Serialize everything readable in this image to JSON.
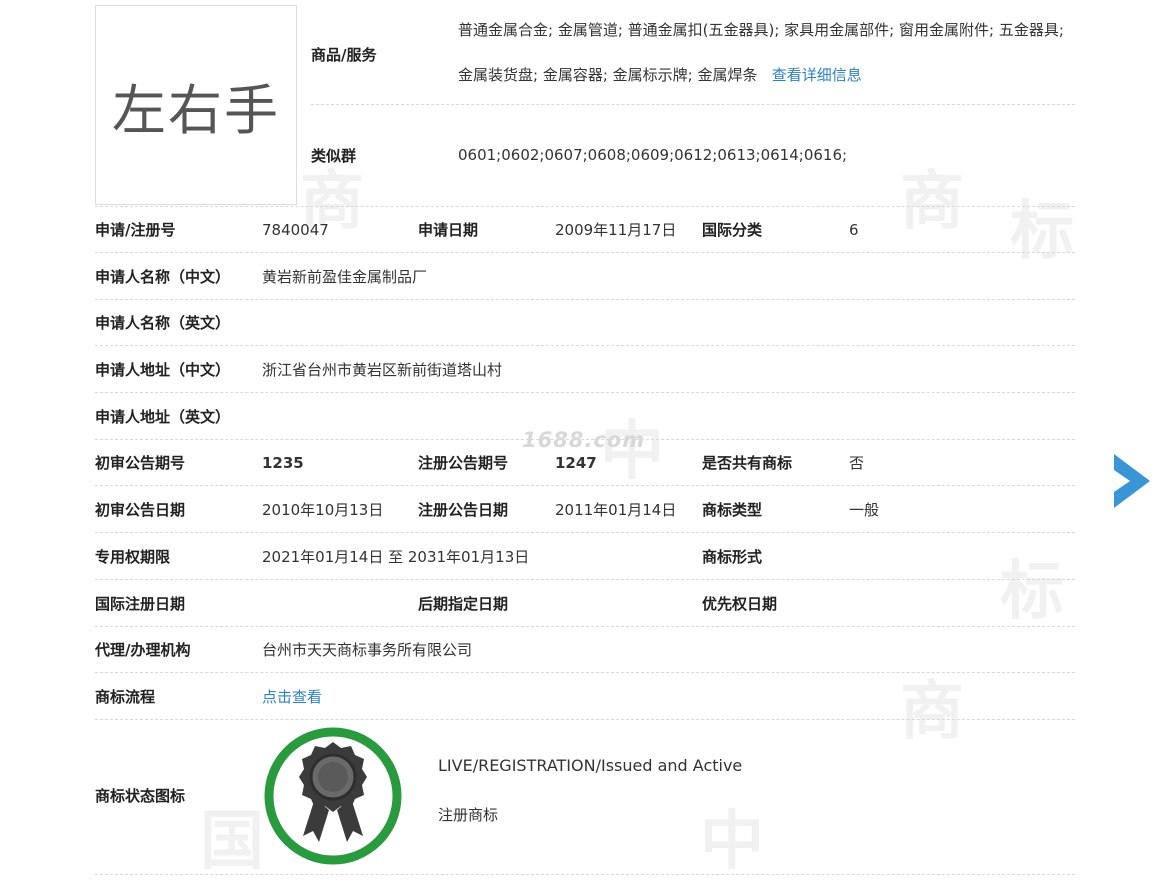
{
  "trademark": {
    "name": "左右手"
  },
  "top": {
    "goods_label": "商品/服务",
    "goods_value": "普通金属合金; 金属管道; 普通金属扣(五金器具); 家具用金属部件; 窗用金属附件; 五金器具; 金属装货盘; 金属容器; 金属标示牌; 金属焊条",
    "goods_link": "查看详细信息",
    "similar_label": "类似群",
    "similar_value": "0601;0602;0607;0608;0609;0612;0613;0614;0616;"
  },
  "rows": {
    "reg_no": {
      "label": "申请/注册号",
      "value": "7840047"
    },
    "apply_date": {
      "label": "申请日期",
      "value": "2009年11月17日"
    },
    "intl_class": {
      "label": "国际分类",
      "value": "6"
    },
    "applicant_cn": {
      "label": "申请人名称（中文）",
      "value": "黄岩新前盈佳金属制品厂"
    },
    "applicant_en": {
      "label": "申请人名称（英文）",
      "value": ""
    },
    "address_cn": {
      "label": "申请人地址（中文）",
      "value": "浙江省台州市黄岩区新前街道塔山村"
    },
    "address_en": {
      "label": "申请人地址（英文）",
      "value": ""
    },
    "prelim_no": {
      "label": "初审公告期号",
      "value": "1235"
    },
    "reg_announce_no": {
      "label": "注册公告期号",
      "value": "1247"
    },
    "shared": {
      "label": "是否共有商标",
      "value": "否"
    },
    "prelim_date": {
      "label": "初审公告日期",
      "value": "2010年10月13日"
    },
    "reg_announce_date": {
      "label": "注册公告日期",
      "value": "2011年01月14日"
    },
    "tm_type": {
      "label": "商标类型",
      "value": "一般"
    },
    "exclusive_period": {
      "label": "专用权期限",
      "value": "2021年01月14日 至 2031年01月13日"
    },
    "tm_form": {
      "label": "商标形式",
      "value": ""
    },
    "intl_reg_date": {
      "label": "国际注册日期",
      "value": ""
    },
    "later_date": {
      "label": "后期指定日期",
      "value": ""
    },
    "priority_date": {
      "label": "优先权日期",
      "value": ""
    },
    "agent": {
      "label": "代理/办理机构",
      "value": "台州市天天商标事务所有限公司"
    },
    "flow": {
      "label": "商标流程",
      "link": "点击查看"
    }
  },
  "status": {
    "label": "商标状态图标",
    "text_en": "LIVE/REGISTRATION/Issued and Active",
    "text_cn": "注册商标",
    "ring_color": "#2a9a3f",
    "icon": "award-ribbon-icon"
  },
  "watermark": {
    "site": "1688.com"
  },
  "colors": {
    "link": "#2a83c2",
    "arrow": "#3a95d6"
  }
}
